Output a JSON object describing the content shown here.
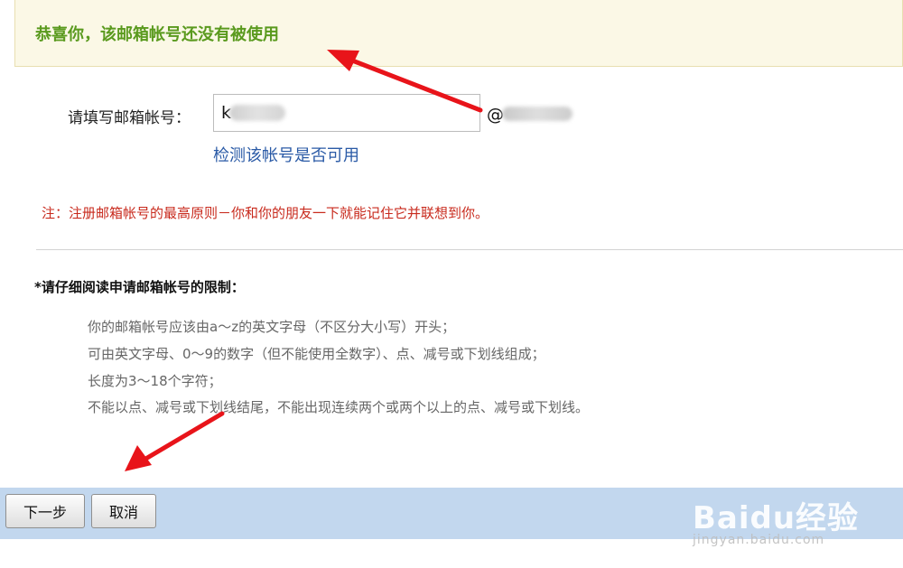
{
  "banner": {
    "message": "恭喜你，该邮箱帐号还没有被使用"
  },
  "form": {
    "label": "请填写邮箱帐号：",
    "username_value": "k",
    "domain_at": "@",
    "check_link": "检测该帐号是否可用"
  },
  "note": "注：注册邮箱帐号的最高原则－你和你的朋友一下就能记住它并联想到你。",
  "rules": {
    "heading": "*请仔细阅读申请邮箱帐号的限制：",
    "items": [
      "你的邮箱帐号应该由a～z的英文字母（不区分大小写）开头；",
      "可由英文字母、0～9的数字（但不能使用全数字）、点、减号或下划线组成；",
      "长度为3～18个字符；",
      "不能以点、减号或下划线结尾，不能出现连续两个或两个以上的点、减号或下划线。"
    ]
  },
  "buttons": {
    "next": "下一步",
    "cancel": "取消"
  },
  "watermark": {
    "main": "Baidu经验",
    "sub": "jingyan.baidu.com"
  },
  "colors": {
    "success_text": "#5a9a1e",
    "link": "#2a5aa6",
    "note": "#c82a1d",
    "footer_bar": "#c2d7ee",
    "annotation_arrow": "#e8141a"
  }
}
